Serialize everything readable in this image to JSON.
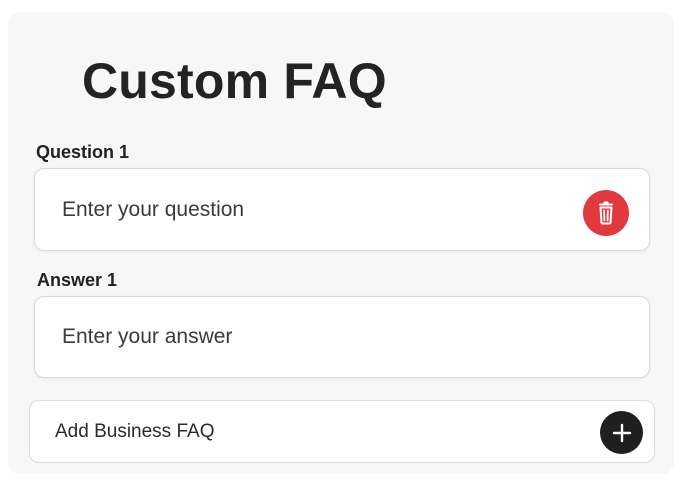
{
  "page": {
    "title": "Custom FAQ"
  },
  "faq_items": [
    {
      "question_label": "Question 1",
      "question_placeholder": "Enter your question",
      "question_value": "",
      "answer_label": "Answer 1",
      "answer_placeholder": "Enter your answer",
      "answer_value": "",
      "delete_icon": "trash-icon"
    }
  ],
  "add_faq": {
    "label": "Add Business FAQ",
    "icon": "plus-icon"
  },
  "colors": {
    "delete_accent": "#e0393e",
    "add_accent": "#1f1f1f",
    "card_background": "#f7f7f7"
  }
}
